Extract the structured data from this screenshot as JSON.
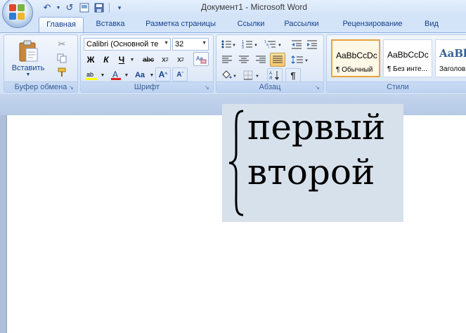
{
  "window": {
    "title": "Документ1 - Microsoft Word"
  },
  "tabs": [
    {
      "label": "Главная",
      "active": true
    },
    {
      "label": "Вставка"
    },
    {
      "label": "Разметка страницы"
    },
    {
      "label": "Ссылки"
    },
    {
      "label": "Рассылки"
    },
    {
      "label": "Рецензирование"
    },
    {
      "label": "Вид"
    }
  ],
  "ribbon": {
    "clipboard": {
      "label": "Буфер обмена",
      "paste_label": "Вставить"
    },
    "font": {
      "label": "Шрифт",
      "font_name": "Calibri (Основной те",
      "font_size": "32"
    },
    "paragraph": {
      "label": "Абзац"
    },
    "styles": {
      "label": "Стили",
      "items": [
        {
          "sample": "AaBbCcDc",
          "name": "¶ Обычный",
          "selected": true
        },
        {
          "sample": "AaBbCcDc",
          "name": "¶ Без инте..."
        },
        {
          "sample": "AaBb",
          "name": "Заголов"
        }
      ]
    }
  },
  "document": {
    "lines": [
      "первый",
      "второй"
    ],
    "selection_color": "#d7e1ec"
  },
  "colors": {
    "highlight": "#ffff00",
    "font_color": "#e02020",
    "accent": "#15428b"
  }
}
